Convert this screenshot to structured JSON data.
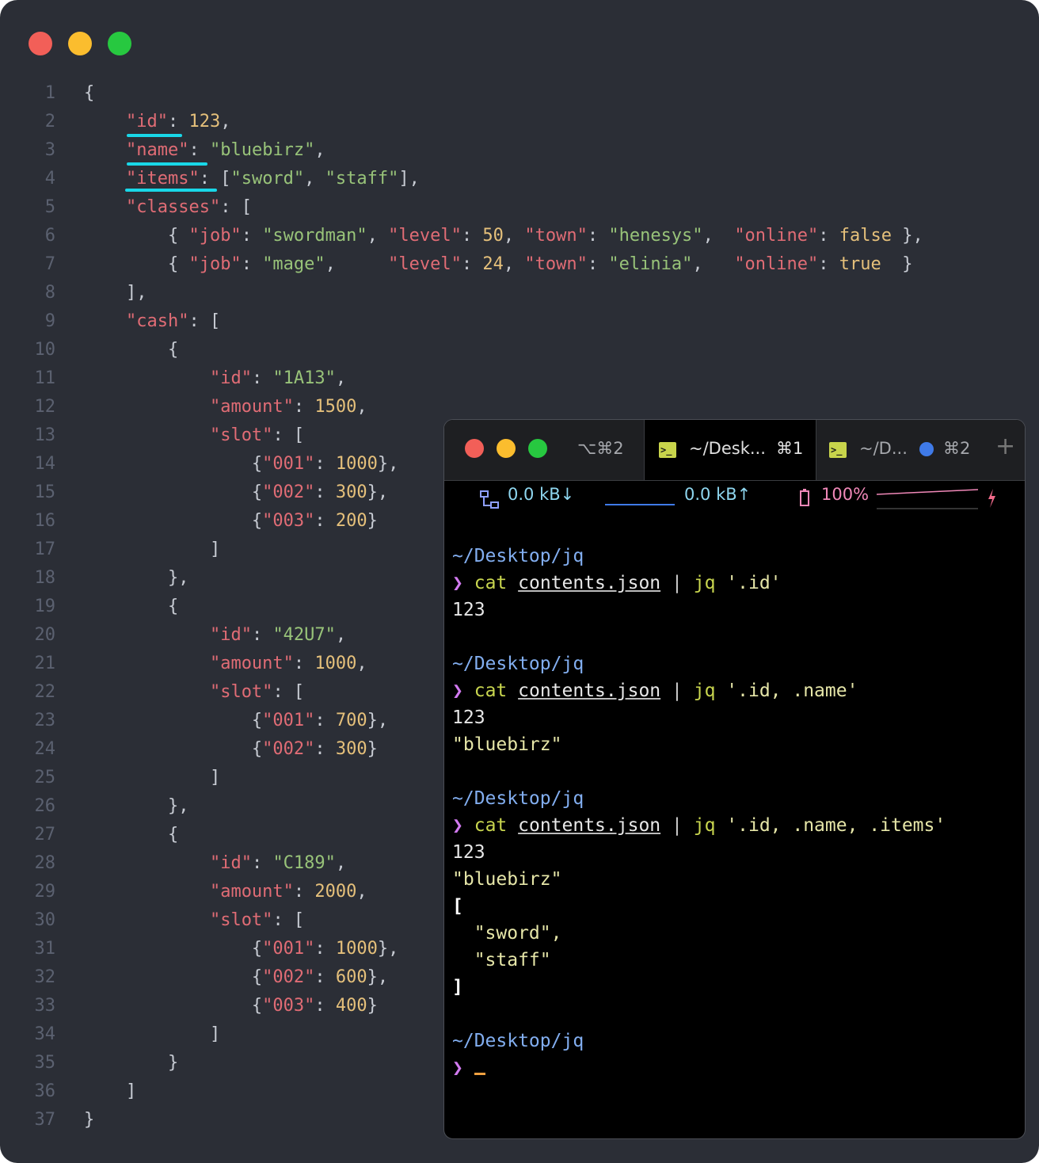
{
  "editor": {
    "line_numbers": [
      "1",
      "2",
      "3",
      "4",
      "5",
      "6",
      "7",
      "8",
      "9",
      "10",
      "11",
      "12",
      "13",
      "14",
      "15",
      "16",
      "17",
      "18",
      "19",
      "20",
      "21",
      "22",
      "23",
      "24",
      "25",
      "26",
      "27",
      "28",
      "29",
      "30",
      "31",
      "32",
      "33",
      "34",
      "35",
      "36",
      "37"
    ],
    "lines": [
      [
        [
          "p",
          "{"
        ]
      ],
      [
        [
          "p",
          "    "
        ],
        [
          "k",
          "\"id\""
        ],
        [
          "p",
          ": "
        ],
        [
          "n",
          "123"
        ],
        [
          "p",
          ","
        ]
      ],
      [
        [
          "p",
          "    "
        ],
        [
          "k",
          "\"name\""
        ],
        [
          "p",
          ": "
        ],
        [
          "s",
          "\"bluebirz\""
        ],
        [
          "p",
          ","
        ]
      ],
      [
        [
          "p",
          "    "
        ],
        [
          "k",
          "\"items\""
        ],
        [
          "p",
          ": ["
        ],
        [
          "s",
          "\"sword\""
        ],
        [
          "p",
          ", "
        ],
        [
          "s",
          "\"staff\""
        ],
        [
          "p",
          "],"
        ]
      ],
      [
        [
          "p",
          "    "
        ],
        [
          "k",
          "\"classes\""
        ],
        [
          "p",
          ": ["
        ]
      ],
      [
        [
          "p",
          "        { "
        ],
        [
          "k",
          "\"job\""
        ],
        [
          "p",
          ": "
        ],
        [
          "s",
          "\"swordman\""
        ],
        [
          "p",
          ", "
        ],
        [
          "k",
          "\"level\""
        ],
        [
          "p",
          ": "
        ],
        [
          "n",
          "50"
        ],
        [
          "p",
          ", "
        ],
        [
          "k",
          "\"town\""
        ],
        [
          "p",
          ": "
        ],
        [
          "s",
          "\"henesys\""
        ],
        [
          "p",
          ",  "
        ],
        [
          "k",
          "\"online\""
        ],
        [
          "p",
          ": "
        ],
        [
          "n",
          "false"
        ],
        [
          "p",
          " },"
        ]
      ],
      [
        [
          "p",
          "        { "
        ],
        [
          "k",
          "\"job\""
        ],
        [
          "p",
          ": "
        ],
        [
          "s",
          "\"mage\""
        ],
        [
          "p",
          ",     "
        ],
        [
          "k",
          "\"level\""
        ],
        [
          "p",
          ": "
        ],
        [
          "n",
          "24"
        ],
        [
          "p",
          ", "
        ],
        [
          "k",
          "\"town\""
        ],
        [
          "p",
          ": "
        ],
        [
          "s",
          "\"elinia\""
        ],
        [
          "p",
          ",   "
        ],
        [
          "k",
          "\"online\""
        ],
        [
          "p",
          ": "
        ],
        [
          "n",
          "true"
        ],
        [
          "p",
          "  }"
        ]
      ],
      [
        [
          "p",
          "    ],"
        ]
      ],
      [
        [
          "p",
          "    "
        ],
        [
          "k",
          "\"cash\""
        ],
        [
          "p",
          ": ["
        ]
      ],
      [
        [
          "p",
          "        {"
        ]
      ],
      [
        [
          "p",
          "            "
        ],
        [
          "k",
          "\"id\""
        ],
        [
          "p",
          ": "
        ],
        [
          "s",
          "\"1A13\""
        ],
        [
          "p",
          ","
        ]
      ],
      [
        [
          "p",
          "            "
        ],
        [
          "k",
          "\"amount\""
        ],
        [
          "p",
          ": "
        ],
        [
          "n",
          "1500"
        ],
        [
          "p",
          ","
        ]
      ],
      [
        [
          "p",
          "            "
        ],
        [
          "k",
          "\"slot\""
        ],
        [
          "p",
          ": ["
        ]
      ],
      [
        [
          "p",
          "                {"
        ],
        [
          "k",
          "\"001\""
        ],
        [
          "p",
          ": "
        ],
        [
          "n",
          "1000"
        ],
        [
          "p",
          "},"
        ]
      ],
      [
        [
          "p",
          "                {"
        ],
        [
          "k",
          "\"002\""
        ],
        [
          "p",
          ": "
        ],
        [
          "n",
          "300"
        ],
        [
          "p",
          "},"
        ]
      ],
      [
        [
          "p",
          "                {"
        ],
        [
          "k",
          "\"003\""
        ],
        [
          "p",
          ": "
        ],
        [
          "n",
          "200"
        ],
        [
          "p",
          "}"
        ]
      ],
      [
        [
          "p",
          "            ]"
        ]
      ],
      [
        [
          "p",
          "        },"
        ]
      ],
      [
        [
          "p",
          "        {"
        ]
      ],
      [
        [
          "p",
          "            "
        ],
        [
          "k",
          "\"id\""
        ],
        [
          "p",
          ": "
        ],
        [
          "s",
          "\"42U7\""
        ],
        [
          "p",
          ","
        ]
      ],
      [
        [
          "p",
          "            "
        ],
        [
          "k",
          "\"amount\""
        ],
        [
          "p",
          ": "
        ],
        [
          "n",
          "1000"
        ],
        [
          "p",
          ","
        ]
      ],
      [
        [
          "p",
          "            "
        ],
        [
          "k",
          "\"slot\""
        ],
        [
          "p",
          ": ["
        ]
      ],
      [
        [
          "p",
          "                {"
        ],
        [
          "k",
          "\"001\""
        ],
        [
          "p",
          ": "
        ],
        [
          "n",
          "700"
        ],
        [
          "p",
          "},"
        ]
      ],
      [
        [
          "p",
          "                {"
        ],
        [
          "k",
          "\"002\""
        ],
        [
          "p",
          ": "
        ],
        [
          "n",
          "300"
        ],
        [
          "p",
          "}"
        ]
      ],
      [
        [
          "p",
          "            ]"
        ]
      ],
      [
        [
          "p",
          "        },"
        ]
      ],
      [
        [
          "p",
          "        {"
        ]
      ],
      [
        [
          "p",
          "            "
        ],
        [
          "k",
          "\"id\""
        ],
        [
          "p",
          ": "
        ],
        [
          "s",
          "\"C189\""
        ],
        [
          "p",
          ","
        ]
      ],
      [
        [
          "p",
          "            "
        ],
        [
          "k",
          "\"amount\""
        ],
        [
          "p",
          ": "
        ],
        [
          "n",
          "2000"
        ],
        [
          "p",
          ","
        ]
      ],
      [
        [
          "p",
          "            "
        ],
        [
          "k",
          "\"slot\""
        ],
        [
          "p",
          ": ["
        ]
      ],
      [
        [
          "p",
          "                {"
        ],
        [
          "k",
          "\"001\""
        ],
        [
          "p",
          ": "
        ],
        [
          "n",
          "1000"
        ],
        [
          "p",
          "},"
        ]
      ],
      [
        [
          "p",
          "                {"
        ],
        [
          "k",
          "\"002\""
        ],
        [
          "p",
          ": "
        ],
        [
          "n",
          "600"
        ],
        [
          "p",
          "},"
        ]
      ],
      [
        [
          "p",
          "                {"
        ],
        [
          "k",
          "\"003\""
        ],
        [
          "p",
          ": "
        ],
        [
          "n",
          "400"
        ],
        [
          "p",
          "}"
        ]
      ],
      [
        [
          "p",
          "            ]"
        ]
      ],
      [
        [
          "p",
          "        }"
        ]
      ],
      [
        [
          "p",
          "    ]"
        ]
      ],
      [
        [
          "p",
          "}"
        ]
      ]
    ]
  },
  "terminal": {
    "tabs": {
      "tab1_shortcut": "⌥⌘2",
      "tab2_label": "~/Desk...",
      "tab2_shortcut": "⌘1",
      "tab3_label": "~/D...",
      "tab3_shortcut": "⌘2",
      "new_tab": "+"
    },
    "status": {
      "download": "0.0 kB↓",
      "upload": "0.0 kB↑",
      "battery": "100%"
    },
    "prompt_symbol": "❯",
    "path": "~/Desktop/jq",
    "cmd_cat": "cat",
    "cmd_file": "contents.json",
    "pipe": "|",
    "cmd_jq": "jq",
    "query1": "'.id'",
    "query2": "'.id, .name'",
    "query3": "'.id, .name, .items'",
    "out_id": "123",
    "out_name": "\"bluebirz\"",
    "out_open": "[",
    "out_item1": "  \"sword\",",
    "out_item2": "  \"staff\"",
    "out_close": "]"
  },
  "colors": {
    "key": "#e06c75",
    "string": "#98c379",
    "number": "#e5c07b",
    "highlight": "#19d7e8",
    "editor_bg": "#2b2e36"
  }
}
